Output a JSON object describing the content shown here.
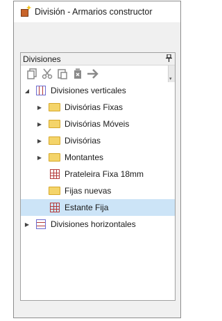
{
  "window": {
    "title": "División - Armarios constructor"
  },
  "panel": {
    "title": "Divisiones",
    "pin_glyph": "ᵽ"
  },
  "toolbar": {
    "buttons": [
      {
        "name": "copy-icon",
        "glyph": "⧉"
      },
      {
        "name": "cut-icon",
        "glyph": "✂"
      },
      {
        "name": "paste-icon",
        "glyph": "⎘"
      },
      {
        "name": "delete-icon",
        "glyph": "🗑"
      },
      {
        "name": "arrow-right-icon",
        "glyph": "➔"
      }
    ]
  },
  "tree": {
    "root_vertical": {
      "label": "Divisiones verticales",
      "expanded": true
    },
    "children": [
      {
        "label": "Divisórias Fixas",
        "type": "folder"
      },
      {
        "label": "Divisórias Móveis",
        "type": "folder"
      },
      {
        "label": "Divisórias",
        "type": "folder"
      },
      {
        "label": "Montantes",
        "type": "folder"
      },
      {
        "label": "Prateleira Fixa 18mm",
        "type": "item"
      },
      {
        "label": "Fijas nuevas",
        "type": "folder"
      },
      {
        "label": "Estante Fija",
        "type": "item",
        "selected": true
      }
    ],
    "root_horizontal": {
      "label": "Divisiones horizontales",
      "expanded": false
    }
  },
  "colors": {
    "selection": "#cce4f7",
    "folder": "#f4d46a",
    "grid_line": "#b33a3a"
  }
}
